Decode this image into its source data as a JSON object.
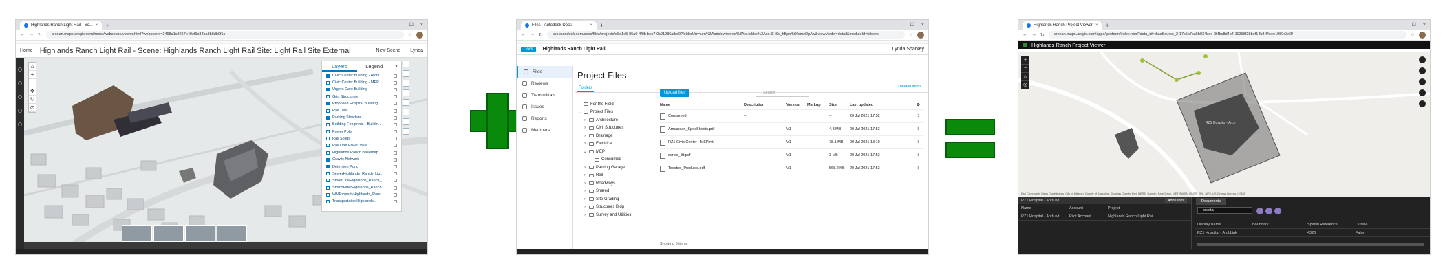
{
  "colors": {
    "sign_green": "#0a8a0a",
    "autodesk_blue": "#0696d7",
    "arcgis_blue": "#0079c1"
  },
  "win1": {
    "tab_title": "Highlands Ranch Light Rail - Sc...",
    "url": "arcnan.maps.arcgis.com/home/webscene/viewer.html?webscene=3468a1c8267e40ef9c34ba8b8db0f1c",
    "home": "Home",
    "scene_title": "Highlands Ranch Light Rail - Scene: Highlands Ranch Light Rail Site: Light Rail Site External",
    "new_scene": "New Scene",
    "user": "Lynda",
    "tab_layers": "Layers",
    "tab_legend": "Legend",
    "layers": [
      {
        "name": "Civic Center Building - Archi...",
        "checked": true
      },
      {
        "name": "Civic Center Building - MEP",
        "checked": false
      },
      {
        "name": "Urgent Care Building",
        "checked": true
      },
      {
        "name": "Grid Structures",
        "checked": false
      },
      {
        "name": "Proposed Hospital Building",
        "checked": true
      },
      {
        "name": "Rail Ties",
        "checked": false
      },
      {
        "name": "Parking Structure",
        "checked": true
      },
      {
        "name": "Building Footprints - Buildin...",
        "checked": false
      },
      {
        "name": "Power Pole",
        "checked": false
      },
      {
        "name": "Rail Solids",
        "checked": false
      },
      {
        "name": "Rail Line Power Wire",
        "checked": false
      },
      {
        "name": "Highlands Ranch Basemap ...",
        "checked": false
      },
      {
        "name": "Gravity Network",
        "checked": true
      },
      {
        "name": "Detention Pond",
        "checked": true
      },
      {
        "name": "SewerHighlands_Ranch_Lig...",
        "checked": false
      },
      {
        "name": "StreetLineHighlands_Ranch_...",
        "checked": false
      },
      {
        "name": "StormwaterHighlands_Ranch...",
        "checked": false
      },
      {
        "name": "WMPropertyHighlands_Ranc...",
        "checked": false
      },
      {
        "name": "TransportationHighlands...",
        "checked": false
      }
    ]
  },
  "sign_plus": "+",
  "sign_equals": "=",
  "win2": {
    "tab_title": "Files - Autodesk Docs",
    "url": "acc.autodesk.com/docs/files/projects/d8a1e5-95a0-4f0b-bcc7-0c01986afba9?folderUrn=urn%3Aadsk.wipprod%3Afs.folder%3Aco.3HSv_hBpx4tiiKsmcOpAw&viewModel=detail&moduleId=folders",
    "docs": "Docs",
    "project": "Highlands Ranch Light Rail",
    "user": "Lynda Sharkey",
    "side": [
      "Files",
      "Reviews",
      "Transmittals",
      "Issues",
      "Reports",
      "Members"
    ],
    "page_title": "Project Files",
    "subtab": "Folders",
    "deleted": "Deleted items",
    "upload": "Upload files",
    "search": "Search",
    "tree": [
      {
        "label": "For the Field",
        "caret": "",
        "depth": 0
      },
      {
        "label": "Project Files",
        "caret": "⌄",
        "depth": 0
      },
      {
        "label": "Architecture",
        "caret": "›",
        "depth": 1
      },
      {
        "label": "Civil Structures",
        "caret": "›",
        "depth": 1
      },
      {
        "label": "Drainage",
        "caret": "›",
        "depth": 1
      },
      {
        "label": "Electrical",
        "caret": "›",
        "depth": 1
      },
      {
        "label": "MEP",
        "caret": "⌄",
        "depth": 1
      },
      {
        "label": "Consumed",
        "caret": "",
        "depth": 2
      },
      {
        "label": "Parking Garage",
        "caret": "›",
        "depth": 1
      },
      {
        "label": "Rail",
        "caret": "›",
        "depth": 1
      },
      {
        "label": "Roadways",
        "caret": "›",
        "depth": 1
      },
      {
        "label": "Shared",
        "caret": "›",
        "depth": 1
      },
      {
        "label": "Site Grading",
        "caret": "›",
        "depth": 1
      },
      {
        "label": "Structures Bldg",
        "caret": "›",
        "depth": 1
      },
      {
        "label": "Survey and Utilities",
        "caret": "›",
        "depth": 1
      }
    ],
    "columns": [
      "Name",
      "Description",
      "Version",
      "Markup",
      "Size",
      "Last updated"
    ],
    "rows": [
      {
        "name": "Consumed",
        "desc": "--",
        "ver": "",
        "markup": "",
        "size": "--",
        "updated": "20 Jul 2021 17:52"
      },
      {
        "name": "Armandan_SpecSheets.pdf",
        "desc": "",
        "ver": "V1",
        "markup": "",
        "size": "4.8 MB",
        "updated": "20 Jul 2021 17:53"
      },
      {
        "name": "RZ1 Civic Center - MEP.rvt",
        "desc": "",
        "ver": "V1",
        "markup": "",
        "size": "78.1 MB",
        "updated": "20 Jul 2021 18:10"
      },
      {
        "name": "series_lift.pdf",
        "desc": "",
        "ver": "V1",
        "markup": "",
        "size": "3 MB",
        "updated": "20 Jul 2021 17:53"
      },
      {
        "name": "Toestrol_Products.pdf",
        "desc": "",
        "ver": "V1",
        "markup": "",
        "size": "568.2 KB",
        "updated": "20 Jul 2021 17:53"
      }
    ],
    "showing": "Showing 5 items"
  },
  "win3": {
    "tab_title": "Highlands Ranch Project Viewer",
    "url": "arcnan.maps.arcgis.com/apps/geoform/index.html?data_id=dataSource_2-17c5b7ca6b034bee-9f4bc8d4b4-19388f28bef14b8-f4eee1950c3d9f",
    "app_title": "Highlands Ranch Project Viewer",
    "map_label": "RZ1 Hospital - Arch",
    "attribution": "Esri Community Maps Contributors, City of Littleton, County of Arapahoe, Douglas County, Esri, HERE, Garmin, SafeGraph, METI/NASA, USGS, EPA, NPS, US Census Bureau, USDA",
    "panel_title": "RZ1 Hospital - Arch.rvt",
    "add_links": "Add Links",
    "cols": [
      "Name",
      "Account",
      "Project"
    ],
    "row": [
      "RZ1 Hospital - Arch.rvt",
      "Pilot Account",
      "Highlands Ranch Light Rail"
    ],
    "documents": "Documents",
    "search_val": "Hospital",
    "rcols": [
      "Display Name",
      "Boundary",
      "Spatial Reference",
      "Outline"
    ],
    "rrow": [
      "RZ1 Hospital - ArchLink",
      "",
      "4326",
      "False"
    ]
  }
}
